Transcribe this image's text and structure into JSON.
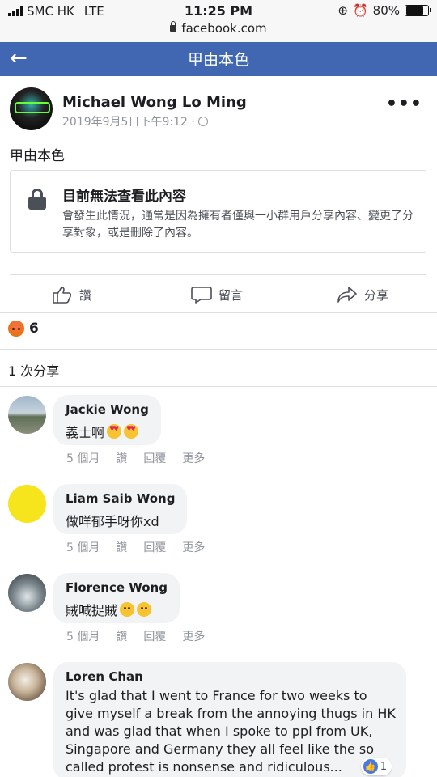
{
  "status": {
    "carrier": "SMC HK",
    "network": "LTE",
    "time": "11:25 PM",
    "battery": "80%",
    "battery_level": 0.8
  },
  "browser": {
    "url": "facebook.com"
  },
  "nav": {
    "title": "甲由本色",
    "back_icon": "arrow-left-icon"
  },
  "post": {
    "author": "Michael Wong Lo Ming",
    "timestamp": "2019年9月5日下午9:12 ·",
    "text": "甲由本色",
    "attachment": {
      "title": "目前無法查看此內容",
      "body": "會發生此情況，通常是因為擁有者僅與一小群用戶分享內容、變更了分享對象，或是刪除了內容。"
    },
    "actions": {
      "like": "讚",
      "comment": "留言",
      "share": "分享"
    },
    "reactions": {
      "type": "angry",
      "count": "6"
    },
    "shares": "1 次分享"
  },
  "comment_actions": {
    "like": "讚",
    "reply": "回覆",
    "more": "更多"
  },
  "comments": [
    {
      "name": "Jackie Wong",
      "text": "義士啊",
      "time": "5 個月"
    },
    {
      "name": "Liam Saib Wong",
      "text": "做咩郁手呀你xd",
      "time": "5 個月"
    },
    {
      "name": "Florence Wong",
      "text": "賊喊捉賊",
      "time": "5 個月"
    },
    {
      "name": "Loren Chan",
      "text": "It's glad that I went to France for two weeks to give myself a break from the annoying thugs in HK and was glad that when I spoke to ppl from UK, Singapore and Germany they all feel like the so called protest is nonsense and ridiculous...",
      "likes": "1"
    }
  ],
  "colors": {
    "brand": "#4267b2",
    "bubble": "#f2f3f5",
    "meta": "#90949c"
  }
}
